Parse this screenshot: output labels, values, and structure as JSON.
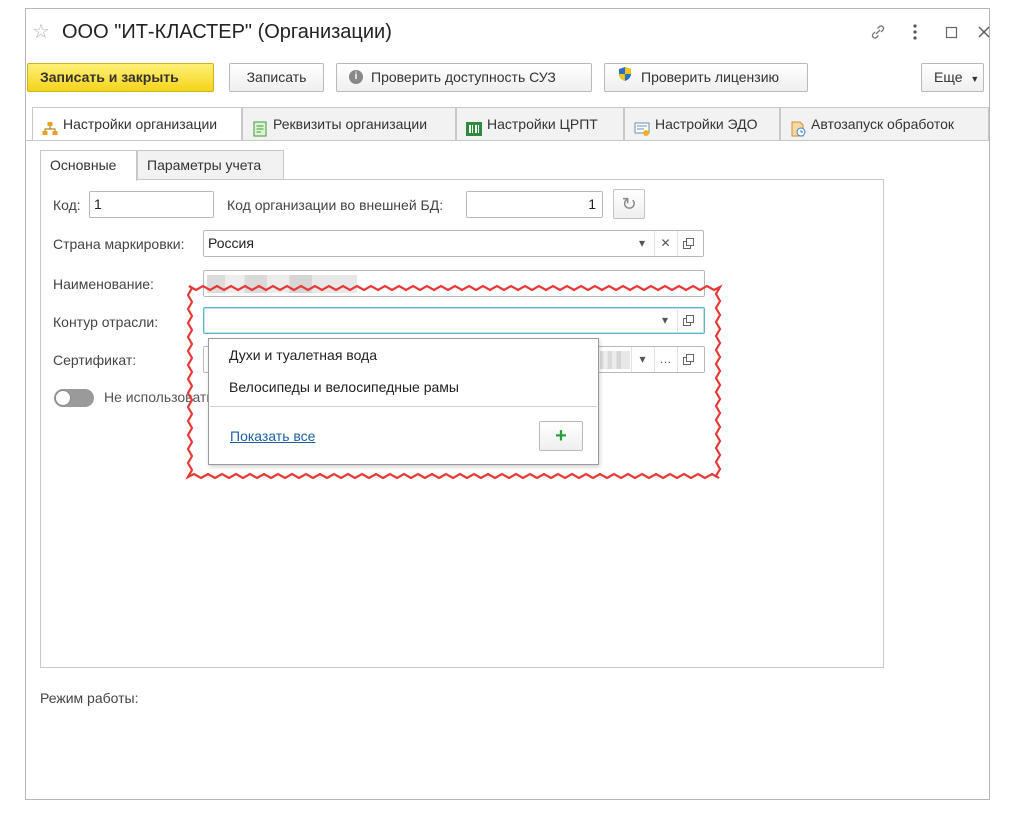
{
  "window": {
    "title": "ООО \"ИТ-КЛАСТЕР\" (Организации)"
  },
  "toolbar": {
    "save_close": "Записать и закрыть",
    "save": "Записать",
    "check_suz": "Проверить доступность СУЗ",
    "check_license": "Проверить лицензию",
    "more": "Еще"
  },
  "tabs": [
    {
      "label": "Настройки организации",
      "icon": "org-structure-icon"
    },
    {
      "label": "Реквизиты организации",
      "icon": "document-icon"
    },
    {
      "label": "Настройки ЦРПТ",
      "icon": "barcode-icon"
    },
    {
      "label": "Настройки ЭДО",
      "icon": "edo-icon"
    },
    {
      "label": "Автозапуск обработок",
      "icon": "autorun-icon"
    }
  ],
  "subtabs": [
    {
      "label": "Основные"
    },
    {
      "label": "Параметры учета"
    }
  ],
  "form": {
    "code_label": "Код:",
    "code_value": "1",
    "ext_code_label": "Код организации во внешней БД:",
    "ext_code_value": "1",
    "country_label": "Страна маркировки:",
    "country_value": "Россия",
    "name_label": "Наименование:",
    "industry_label": "Контур отрасли:",
    "industry_value": "",
    "certificate_label": "Сертификат:",
    "toggle_label": "Не использовать"
  },
  "dropdown": {
    "items": [
      {
        "label": "Духи и туалетная вода"
      },
      {
        "label": "Велосипеды и велосипедные рамы"
      }
    ],
    "show_all": "Показать все",
    "add_symbol": "+"
  },
  "footer": {
    "mode_label": "Режим работы:"
  },
  "colors": {
    "primary_button": "#f5d31c",
    "highlight_border": "#e53935",
    "link": "#1f5fa8",
    "focus_border": "#5fb3c7",
    "add_icon": "#23a23a"
  }
}
